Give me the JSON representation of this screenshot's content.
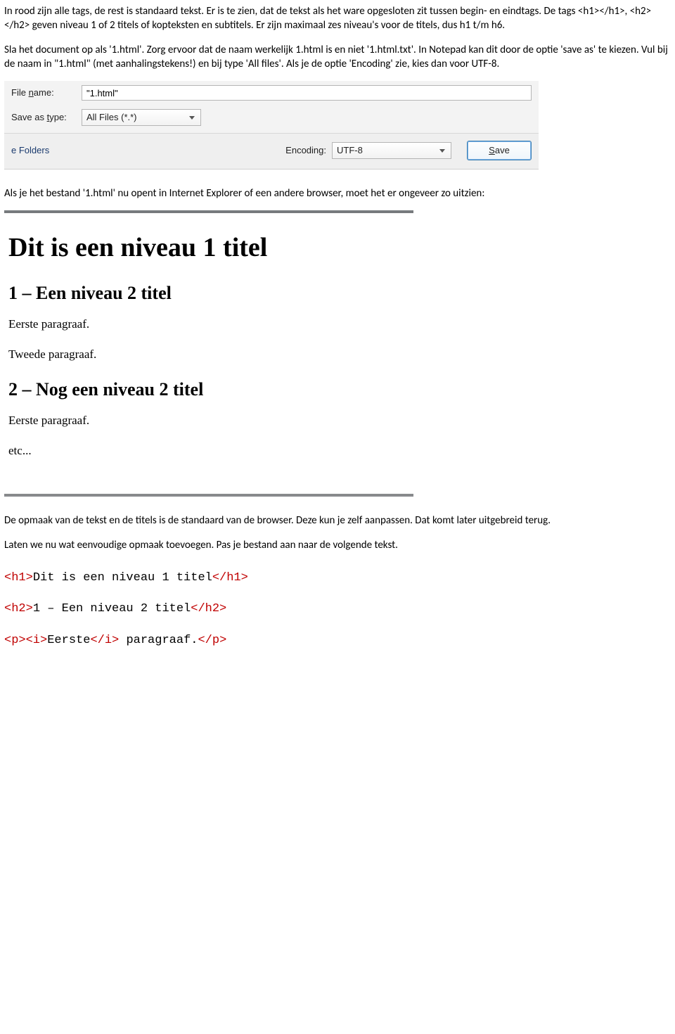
{
  "para1": "In rood zijn alle tags, de rest is standaard tekst. Er is te zien, dat de tekst als het ware opgesloten zit tussen begin- en eindtags. De tags <h1></h1>, <h2></h2> geven niveau 1 of 2 titels of kopteksten en subtitels. Er zijn maximaal zes niveau's voor de titels, dus h1 t/m h6.",
  "para2": "Sla het document op als '1.html'. Zorg ervoor dat de naam werkelijk 1.html is en niet '1.html.txt'. In Notepad kan dit door de optie 'save as' te kiezen. Vul bij de naam in \"1.html\" (met aanhalingstekens!) en bij type 'All files'. Als je de optie 'Encoding' zie, kies dan voor UTF-8.",
  "dialog": {
    "filename_label_pre": "File ",
    "filename_label_ul": "n",
    "filename_label_post": "ame:",
    "filename_value": "\"1.html\"",
    "type_label_pre": "Save as ",
    "type_label_ul": "t",
    "type_label_post": "ype:",
    "type_value": "All Files  (*.*)",
    "folders": "e Folders",
    "encoding_label_ul": "E",
    "encoding_label_post": "ncoding:",
    "encoding_value": "UTF-8",
    "save_ul": "S",
    "save_post": "ave"
  },
  "para3": "Als je het bestand '1.html' nu opent in Internet Explorer of een andere browser, moet het er ongeveer zo uitzien:",
  "browser": {
    "h1": "Dit is een niveau 1 titel",
    "h2a": "1 – Een niveau 2 titel",
    "p1": "Eerste paragraaf.",
    "p2": "Tweede paragraaf.",
    "h2b": "2 – Nog een niveau 2 titel",
    "p3": "Eerste paragraaf.",
    "p4": "etc..."
  },
  "para4": "De opmaak van de tekst en de titels is de standaard van de browser. Deze kun je zelf aanpassen. Dat komt later uitgebreid terug.",
  "para5": "Laten we nu wat eenvoudige opmaak toevoegen. Pas je bestand aan naar de volgende tekst.",
  "code": {
    "l1a": "<h1>",
    "l1b": "Dit is een niveau 1 titel",
    "l1c": "</h1>",
    "l2a": "<h2>",
    "l2b": "1 – Een niveau 2 titel",
    "l2c": "</h2>",
    "l3a": "<p><i>",
    "l3b": "Eerste",
    "l3c": "</i>",
    "l3d": " paragraaf.",
    "l3e": "</p>"
  }
}
